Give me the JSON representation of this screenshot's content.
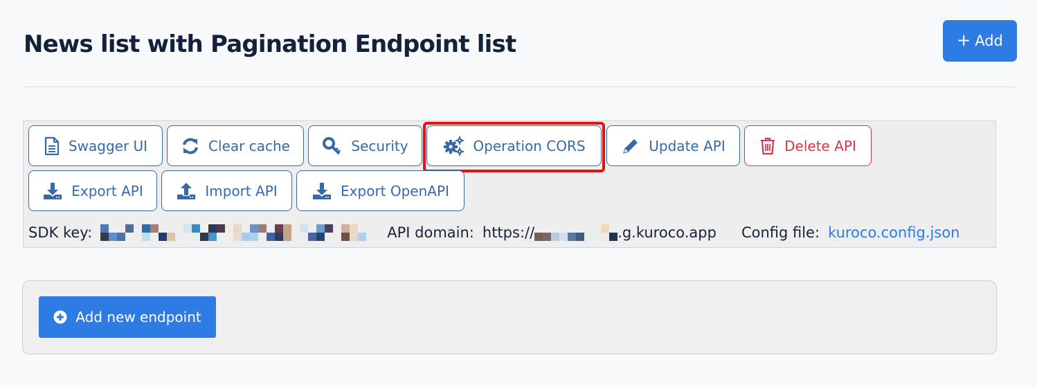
{
  "header": {
    "title": "News list with Pagination Endpoint list",
    "add_button": {
      "icon": "plus-icon",
      "label": "Add"
    }
  },
  "toolbar": {
    "buttons": [
      {
        "label": "Swagger UI",
        "icon": "document-icon"
      },
      {
        "label": "Clear cache",
        "icon": "refresh-icon"
      },
      {
        "label": "Security",
        "icon": "key-icon"
      },
      {
        "label": "Operation CORS",
        "icon": "gears-icon",
        "highlighted": true
      },
      {
        "label": "Update API",
        "icon": "pencil-icon"
      },
      {
        "label": "Delete API",
        "icon": "trash-icon",
        "variant": "danger"
      },
      {
        "label": "Export API",
        "icon": "download-icon"
      },
      {
        "label": "Import API",
        "icon": "upload-icon"
      },
      {
        "label": "Export OpenAPI",
        "icon": "download-icon"
      }
    ],
    "info": {
      "sdk_key_label": "SDK key:",
      "sdk_key_value": "[redacted]",
      "api_domain_label": "API domain:",
      "api_domain_prefix": "https://",
      "api_domain_suffix": ".g.kuroco.app",
      "config_file_label": "Config file:",
      "config_file_link": "kuroco.config.json"
    }
  },
  "endpoints": {
    "add_new_label": "Add new endpoint",
    "add_new_icon": "plus-circle-icon"
  },
  "colors": {
    "primary": "#2d7be3",
    "outline": "#3569aa",
    "danger": "#d9344c",
    "highlight": "#e0150f",
    "title": "#14213a"
  }
}
